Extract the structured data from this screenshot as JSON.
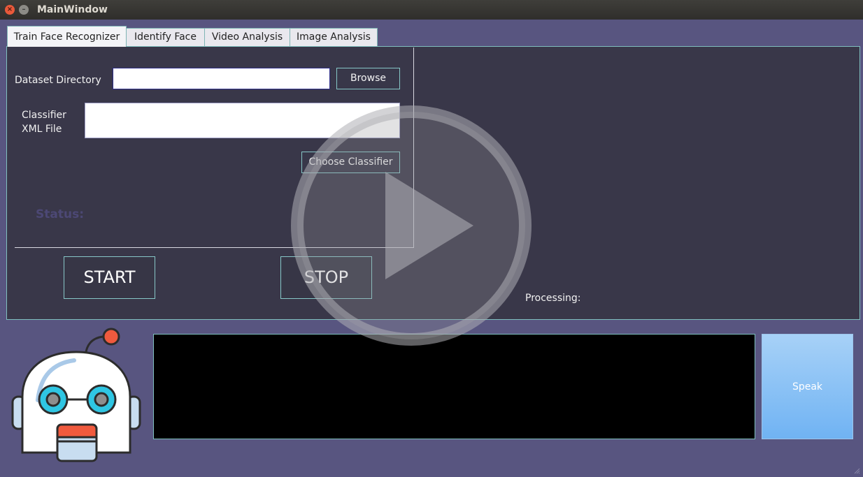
{
  "window": {
    "title": "MainWindow",
    "close_glyph": "×",
    "minimize_glyph": "–"
  },
  "tabs": [
    {
      "label": "Train Face Recognizer",
      "active": true
    },
    {
      "label": "Identify Face",
      "active": false
    },
    {
      "label": "Video Analysis",
      "active": false
    },
    {
      "label": "Image Analysis",
      "active": false
    }
  ],
  "train": {
    "dataset_label": "Dataset Directory",
    "dataset_value": "",
    "browse_label": "Browse",
    "classifier_label_line1": "Classifier",
    "classifier_label_line2": "XML File",
    "classifier_value": "",
    "choose_classifier_label": "Choose Classifier",
    "status_label": "Status:",
    "start_label": "START",
    "stop_label": "STOP",
    "processing_label": "Processing:"
  },
  "bottom": {
    "console_text": "",
    "speak_label": "Speak"
  },
  "icons": {
    "play_overlay": "play-circle-icon",
    "assistant": "robot-icon",
    "resize": "resize-grip-icon"
  },
  "colors": {
    "window_bg": "#585580",
    "panel_bg": "#393749",
    "accent_border": "#7fbfbf",
    "speak_button": "#8cc2f5",
    "status_text": "#4c4875"
  }
}
